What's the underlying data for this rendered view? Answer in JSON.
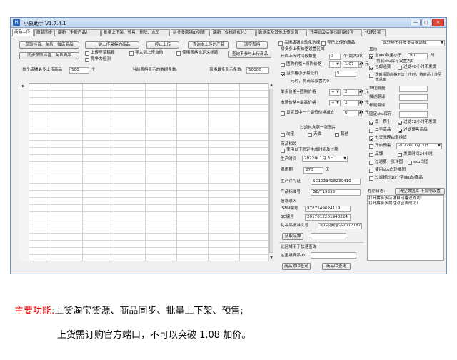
{
  "window": {
    "title": "小象助手 V1.7.4.1",
    "controls": [
      "—",
      "□",
      "✕"
    ]
  },
  "tabs": [
    "商品上传",
    "商品同步",
    "翻新（全新产品）",
    "批量上下架、预售、删除、水印",
    "拼多多店铺ID列表",
    "翻新（仅标题优化）",
    "数据库及其他上传设置",
    "违禁词及关键词替换设置",
    "代理设置"
  ],
  "toolbar": {
    "buttons_row1": [
      "获取抖音、淘系、微店商品",
      "一键上传采集的商品",
      "停止上传",
      "查询未上传的产品",
      "清空表格"
    ],
    "buttons_row2": [
      "同步获取抖音、淘系商品"
    ],
    "check_upload_all": "上传至草稿箱",
    "check_import_auto": "导入到上传自动",
    "check_use_custom_title": "使用表格自定义标题",
    "check_compete": "竞争力检测",
    "query_uploaded_button": "查询不参与上传商品",
    "check_close_auto_stock": "关闭店铺自动化选择",
    "check_login_uploaded": "登已上传的商品"
  },
  "stats": {
    "per_shop_label": "单个店铺最多上传商品",
    "per_shop_value": "500",
    "per_shop_unit": "个",
    "current_count_label": "当前表格显示的数据条数:",
    "max_rows_label": "表格最多显示条数:",
    "max_rows_value": "50000"
  },
  "right_panel": {
    "shop_select_placeholder": "此处用于拼多多店铺选择",
    "price_section_label": "拼多多上传价格设置区域",
    "open_upload_interval_label": "开启上传时间段数量",
    "open_upload_interval_value": "3",
    "open_upload_interval_note": "个(最大20)",
    "group_price_label": "团购价格=原购价格",
    "group_price_op": "+",
    "group_price_value": "1.07",
    "group_price_unit": "元",
    "min_price_label": "当价格小于最低价",
    "min_price_value": "5",
    "min_price_note": "元时，将商品设置为0",
    "single_price_label": "单买价格=团购价格",
    "single_price_op": "+",
    "single_price_value": "2",
    "single_price_unit": "元",
    "market_price_label": "市场价格=最高价格",
    "market_price_op": "+",
    "market_price_value": "2",
    "market_price_unit": "元",
    "min_price_check": "设置其中一个最低价格减去",
    "min_price_check_value": "0",
    "min_price_check_unit": "元",
    "filter_label": "过滤包含第一张图片",
    "taobao": "淘宝",
    "tmall": "天猫",
    "others": "其他",
    "product_related": "商品相关",
    "use_following": "使用以下固定生成时间及过期",
    "prod_time_label": "生产时间",
    "prod_time_value": "2022年 1月 3日",
    "shelf_life_label": "保质期",
    "shelf_life_value": "270",
    "shelf_life_unit": "天",
    "license_label": "生产许可证",
    "license_value": "SC1033418230410",
    "standard_label": "产品标准号",
    "standard_value": "GB/T19855",
    "info_label": "信息录入",
    "isbn_label": "ISBN编号",
    "isbn_value": "9787549624119",
    "cc_label": "3C编号",
    "cc_value": "2017012201940224",
    "cosmetic_label": "化妆品批准文号",
    "cosmetic_value": "粤G妆网备字2017187",
    "get_product_button": "获取品牌",
    "below_label": "此区域用于快速查询",
    "search_label": "这里填商品ID",
    "source_query_button": "商品源ID查询",
    "product_query_button": "商品ID查询"
  },
  "far_right": {
    "other_label": "其他",
    "check_sku_min": "当sku数量小于",
    "sku_min_value": "80",
    "sku_min_unit": "时",
    "sku_min_note": "将此sku库存设置为0",
    "check_freight": "包邮运费",
    "check_72h": "过滤48小时不发货",
    "check_auto_upload": "遇到相同价格无法上传时，将商品上传至普通库",
    "unit_price_label": "单位限量",
    "desc_label": "描述翻译",
    "title_label": "标题翻译",
    "fixed_sku_label": "固定sku库存",
    "check_one_buy": "假一罚十",
    "check_72h_2": "过滤72小时不发货",
    "check_second_hand": "二手商品",
    "check_filter_presale": "过滤预售商品",
    "check_7days": "七天无理由退换货",
    "check_presale": "开启预售",
    "presale_date": "2022年 1月 3日",
    "check_sample": "品牌",
    "check_ship_24": "发货时间24小时",
    "check_filter_first": "过滤第一张详图",
    "check_sku_img": "sku白图",
    "check_use_sku_img": "使用sku白轮播图",
    "check_filter_10": "过滤超过10个字sku的商品",
    "log_label": "程序日志:",
    "clear_log_button": "清空数据库-不影响设置",
    "log_lines": [
      "打开拼多多店铺自动建议成功!",
      "打开拼多多属性对应表成功!"
    ]
  },
  "captions": {
    "line1_red": "主要功能:",
    "line1_rest": "上货淘宝货源、商品同步、批量上下架、预售;",
    "line2": "上货需订购官方端口，不可以突破 1.08 加价。"
  }
}
